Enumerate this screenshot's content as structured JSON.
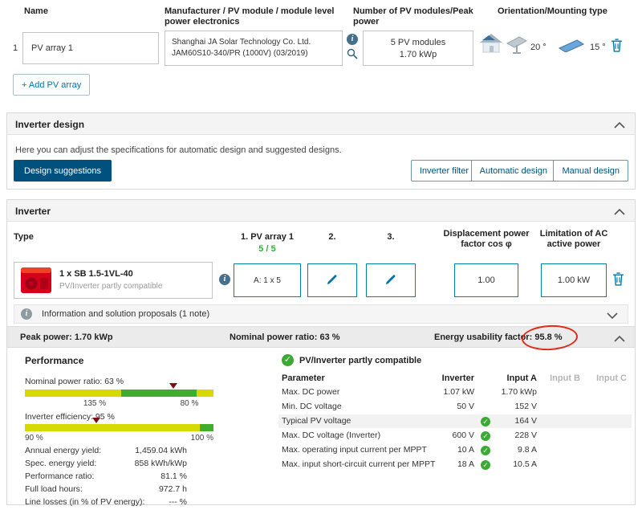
{
  "icons": {
    "check": "✓",
    "info": "i"
  },
  "colors": {
    "accent": "#0076a8",
    "dark_button": "#00517e",
    "green": "#3aaa35",
    "gauge_yellow": "#d6da00",
    "gauge_green": "#3fae2a",
    "annotation_red": "#df2a1a",
    "inverter_red": "#d5001c"
  },
  "pv_table": {
    "headers": {
      "name": "Name",
      "manufacturer": "Manufacturer / PV module / module level power electronics",
      "modules": "Number of PV modules/Peak power",
      "orientation": "Orientation/Mounting type"
    },
    "row": {
      "index": "1",
      "name": "PV array 1",
      "module_line1": "Shanghai JA Solar Technology Co. Ltd.",
      "module_line2": "JAM60S10-340/PR (1000V) (03/2019)",
      "modules_count": "5 PV modules",
      "peak_power": "1.70 kWp",
      "roof_tilt": "20 °",
      "free_tilt": "15 °"
    },
    "add_button": "+ Add PV array"
  },
  "inverter_design": {
    "title": "Inverter design",
    "description": "Here you can adjust the specifications for automatic design and suggested designs.",
    "design_suggestions": "Design suggestions",
    "inverter_filter": "Inverter filter",
    "automatic_design": "Automatic design",
    "manual_design": "Manual design"
  },
  "inverter": {
    "title": "Inverter",
    "headers": {
      "type": "Type",
      "array1": "1. PV array 1",
      "array1_count": "5 / 5",
      "array2": "2.",
      "array3": "3.",
      "cos_phi": "Displacement power factor cos φ",
      "ac_limit": "Limitation of AC active power"
    },
    "row": {
      "name": "1 x SB 1.5-1VL-40",
      "compatibility": "PV/Inverter partly compatible",
      "input_a": "A: 1 x 5",
      "cos_phi": "1.00",
      "ac_limit": "1.00 kW"
    },
    "info_bar": "Information and solution proposals (1 note)",
    "summary": {
      "peak_power_label": "Peak power:",
      "peak_power_value": "1.70 kWp",
      "nominal_ratio_label": "Nominal power ratio:",
      "nominal_ratio_value": "63 %",
      "usability_label": "Energy usability factor:",
      "usability_value": "95.8 %"
    },
    "performance": {
      "title": "Performance",
      "nominal_ratio": "Nominal power ratio: 63 %",
      "gauge1_label_left": "135 %",
      "gauge1_label_right": "80 %",
      "efficiency": "Inverter efficiency: 95 %",
      "gauge2_label_left": "90 %",
      "gauge2_label_right": "100 %",
      "stats": [
        {
          "label": "Annual energy yield:",
          "value": "1,459.04 kWh"
        },
        {
          "label": "Spec. energy yield:",
          "value": "858 kWh/kWp"
        },
        {
          "label": "Performance ratio:",
          "value": "81.1 %"
        },
        {
          "label": "Full load hours:",
          "value": "972.7 h"
        },
        {
          "label": "Line losses (in % of PV energy):",
          "value": "--- %"
        }
      ]
    },
    "compatibility": {
      "title": "PV/Inverter partly compatible",
      "headers": [
        "Parameter",
        "Inverter",
        "Input A",
        "Input B",
        "Input C"
      ],
      "rows": [
        {
          "param": "Max. DC power",
          "inverter": "1.07 kW",
          "input_a": "1.70 kWp"
        },
        {
          "param": "Min. DC voltage",
          "inverter": "50 V",
          "input_a": "152 V"
        },
        {
          "param": "Typical PV voltage",
          "inverter": "",
          "input_a": "164 V"
        },
        {
          "param": "Max. DC voltage (Inverter)",
          "inverter": "600 V",
          "input_a": "228 V"
        },
        {
          "param": "Max. operating input current per MPPT",
          "inverter": "10 A",
          "input_a": "9.8 A"
        },
        {
          "param": "Max. input short-circuit current per MPPT",
          "inverter": "18 A",
          "input_a": "10.5 A"
        }
      ]
    }
  }
}
